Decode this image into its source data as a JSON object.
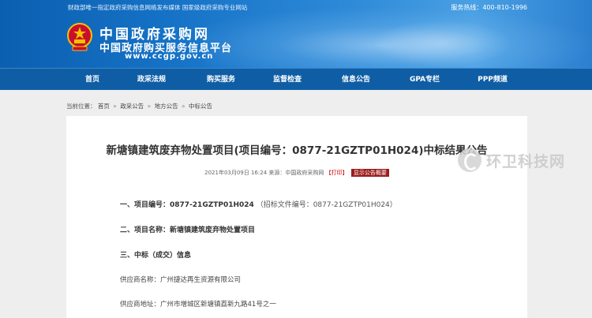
{
  "header": {
    "topbar_left": "财政部唯一指定政府采购信息网络发布媒体  国家级政府采购专业网站",
    "service_hotline": "服务热线：400-810-1996",
    "logo_title": "中国政府采购网",
    "logo_subtitle": "中国政府购买服务信息平台",
    "logo_url": "www.ccgp.gov.cn"
  },
  "nav": {
    "items": [
      {
        "label": "首页"
      },
      {
        "label": "政采法规"
      },
      {
        "label": "购买服务"
      },
      {
        "label": "监督检查"
      },
      {
        "label": "信息公告"
      },
      {
        "label": "GPA专栏"
      },
      {
        "label": "PPP频道"
      }
    ]
  },
  "breadcrumb": {
    "prefix": "当前位置：",
    "items": [
      "首页",
      "政采公告",
      "地方公告",
      "中标公告"
    ],
    "separator": "»"
  },
  "article": {
    "title": "新塘镇建筑废弃物处置项目(项目编号：0877-21GZTP01H024)中标结果公告",
    "meta_date": "2021年03月09日 16:24 来源：中国政府采购网",
    "meta_print": "【打印】",
    "meta_summary": "显示公告概要",
    "sections": {
      "s1_label": "一、项目编号：",
      "s1_value": "0877-21GZTP01H024",
      "s1_note": "（招标文件编号：0877-21GZTP01H024）",
      "s2_label": "二、项目名称：",
      "s2_value": "新塘镇建筑废弃物处置项目",
      "s3_label": "三、中标（成交）信息"
    },
    "supplier_name_label": "供应商名称：",
    "supplier_name": "广州捷达再生资源有限公司",
    "supplier_addr_label": "供应商地址：",
    "supplier_addr": "广州市增城区新塘镇荔新九路41号之一"
  },
  "watermark": {
    "text": "环卫科技网"
  },
  "colors": {
    "nav_bg": "#0f5ea5",
    "banner_blue": "#1673c7",
    "summary_btn": "#9b1c1c"
  }
}
